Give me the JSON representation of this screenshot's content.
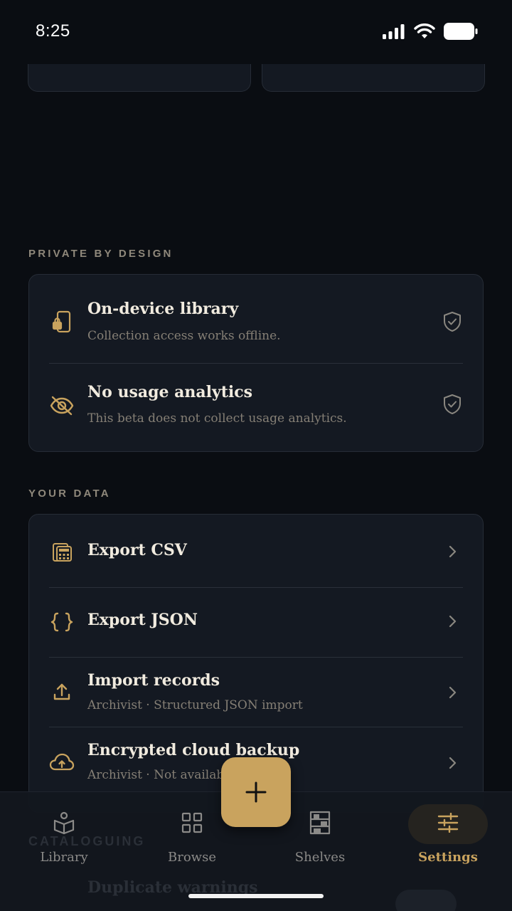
{
  "status_bar": {
    "time": "8:25"
  },
  "sections": {
    "privacy": {
      "label": "PRIVATE BY DESIGN",
      "items": [
        {
          "title": "On-device library",
          "subtitle": "Collection access works offline.",
          "icon": "phone-lock-icon",
          "trail": "shield-check-icon"
        },
        {
          "title": "No usage analytics",
          "subtitle": "This beta does not collect usage analytics.",
          "icon": "eye-off-icon",
          "trail": "shield-check-icon"
        }
      ]
    },
    "data": {
      "label": "YOUR DATA",
      "items": [
        {
          "title": "Export CSV",
          "icon": "calculator-icon"
        },
        {
          "title": "Export JSON",
          "icon": "braces-icon"
        },
        {
          "title": "Import records",
          "subtitle": "Archivist · Structured JSON import",
          "icon": "upload-icon"
        },
        {
          "title": "Encrypted cloud backup",
          "subtitle": "Archivist · Not available in beta",
          "icon": "cloud-upload-icon"
        }
      ]
    },
    "cataloguing": {
      "label": "CATALOGUING",
      "first_item": "Duplicate warnings"
    }
  },
  "nav": {
    "items": [
      {
        "label": "Library",
        "icon": "book-stand-icon"
      },
      {
        "label": "Browse",
        "icon": "grid-icon"
      },
      {
        "label": "Shelves",
        "icon": "bookshelf-icon"
      },
      {
        "label": "Settings",
        "icon": "sliders-icon"
      }
    ],
    "active": "Settings"
  },
  "fab": {
    "icon": "plus-icon"
  },
  "colors": {
    "accent": "#c9a35e",
    "background": "#0a0d12",
    "card": "#141922",
    "muted": "#857f75"
  }
}
